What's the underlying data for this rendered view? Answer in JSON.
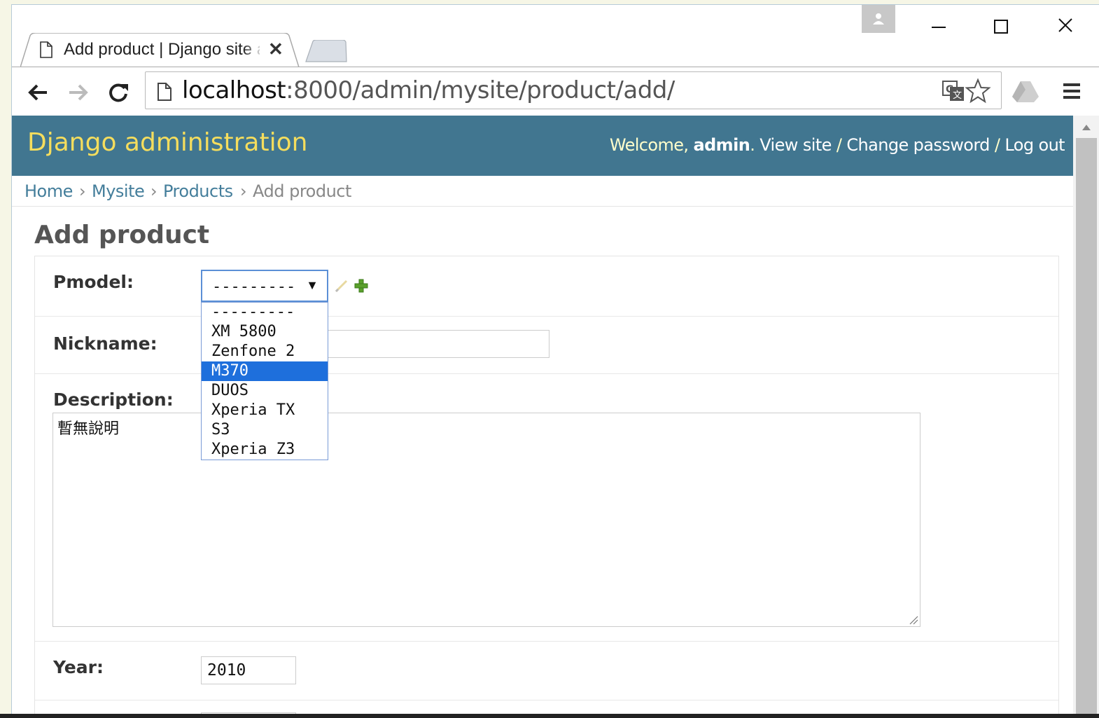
{
  "browser": {
    "tab_title": "Add product | Django site admin",
    "url_host": "localhost",
    "url_rest": ":8000/admin/mysite/product/add/"
  },
  "header": {
    "site_title": "Django administration",
    "welcome": "Welcome,",
    "username": "admin",
    "view_site": "View site",
    "sep": "/",
    "change_password": "Change password",
    "log_out": "Log out"
  },
  "breadcrumbs": {
    "home": "Home",
    "app": "Mysite",
    "model": "Products",
    "current": "Add product",
    "sep": "›"
  },
  "page_title": "Add product",
  "form": {
    "pmodel_label": "Pmodel:",
    "pmodel_value": "---------",
    "pmodel_options": [
      "---------",
      "XM 5800",
      "Zenfone 2",
      "M370",
      "DUOS",
      "Xperia TX",
      "S3",
      "Xperia Z3"
    ],
    "pmodel_highlighted": "M370",
    "nickname_label": "Nickname:",
    "nickname_value": "",
    "description_label": "Description:",
    "description_value": "暫無說明",
    "year_label": "Year:",
    "year_value": "2010"
  },
  "icons": {
    "tab": "page-icon",
    "close": "close-icon",
    "back": "back-arrow-icon",
    "forward": "forward-arrow-icon",
    "reload": "reload-icon",
    "translate": "translate-icon",
    "bookmark": "star-icon",
    "drive": "drive-icon",
    "menu": "hamburger-menu-icon",
    "edit": "pencil-icon",
    "add": "plus-icon"
  },
  "colors": {
    "header_bg": "#417690",
    "site_title": "#f5dd5d",
    "link": "#447e9b",
    "option_highlight": "#1e6fdc"
  }
}
